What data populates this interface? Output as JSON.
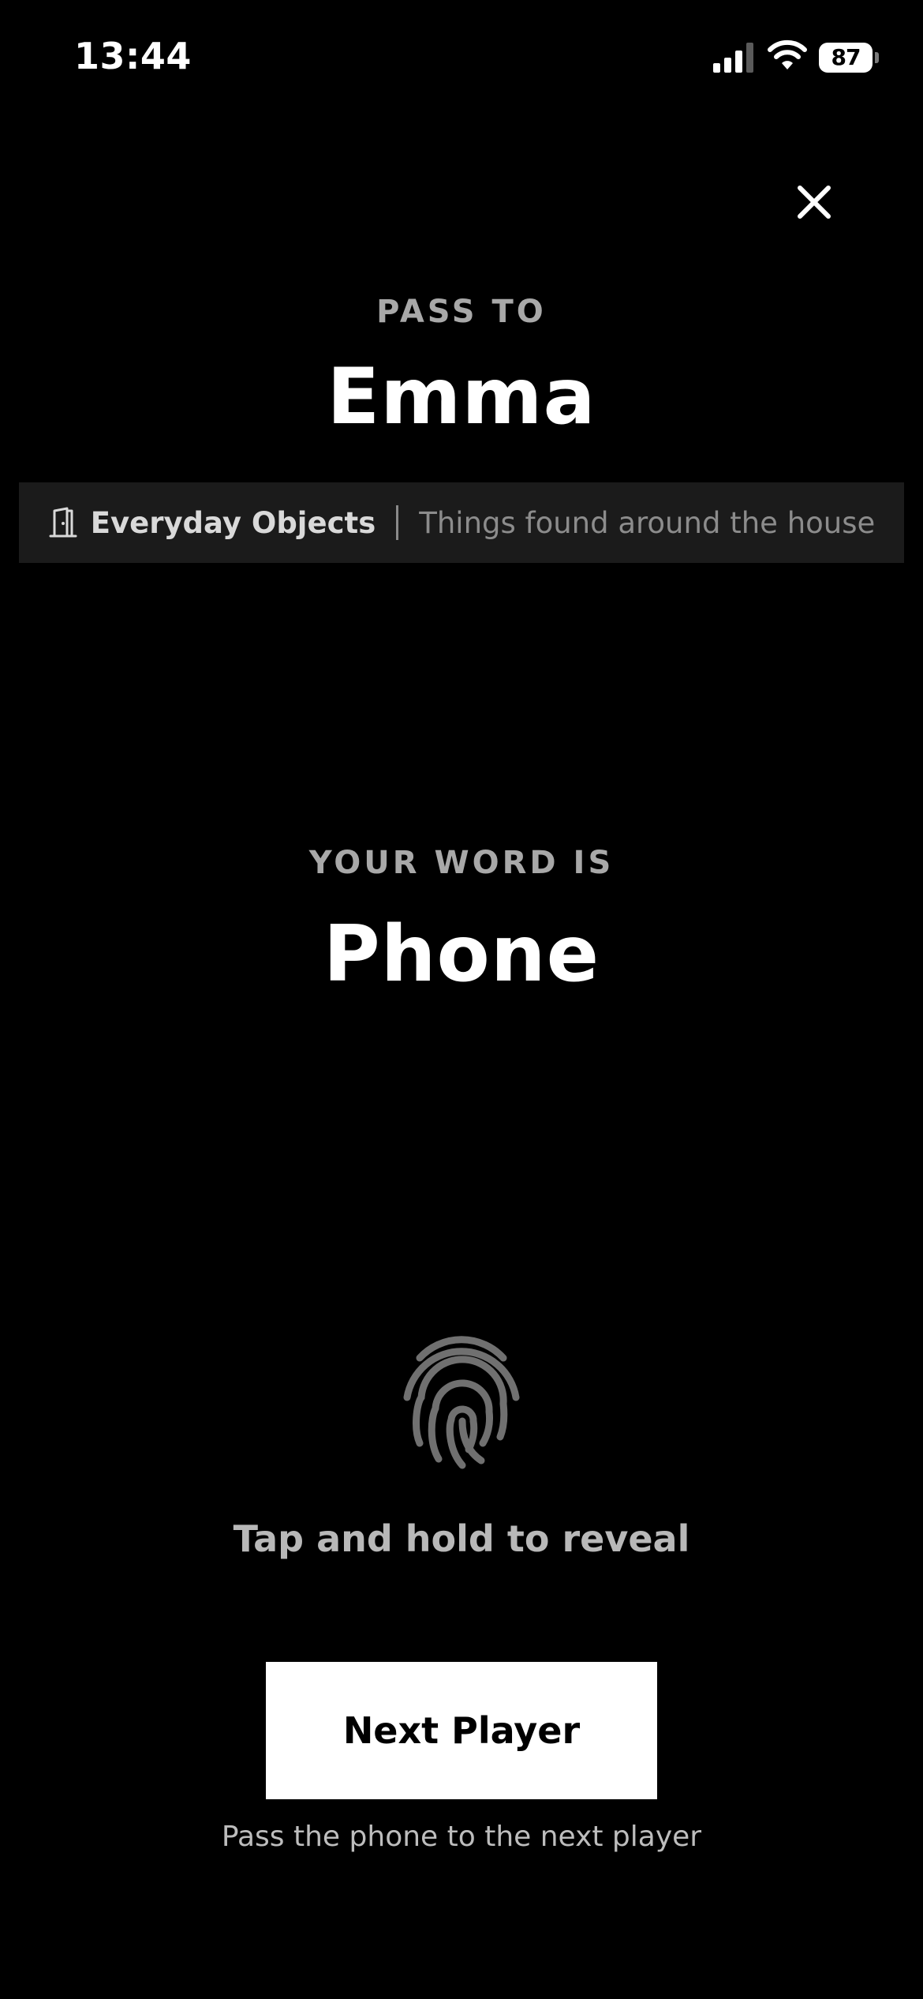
{
  "status_bar": {
    "time": "13:44",
    "battery_level": "87",
    "icons": [
      "signal-icon",
      "wifi-icon",
      "battery-icon"
    ]
  },
  "header": {
    "close_icon": "close-icon",
    "pass_label": "PASS TO",
    "player_name": "Emma"
  },
  "category": {
    "icon": "door-icon",
    "name": "Everyday Objects",
    "description": "Things found around the house"
  },
  "word": {
    "label": "YOUR WORD IS",
    "value": "Phone"
  },
  "reveal": {
    "icon": "fingerprint-icon",
    "hint": "Tap and hold to reveal"
  },
  "next": {
    "button_label": "Next Player",
    "caption": "Pass the phone to the next player"
  },
  "colors": {
    "background": "#000000",
    "banner": "#1b1b1b",
    "muted_text": "#a8a8a8",
    "icon_gray": "#707070",
    "button": "#ffffff"
  }
}
